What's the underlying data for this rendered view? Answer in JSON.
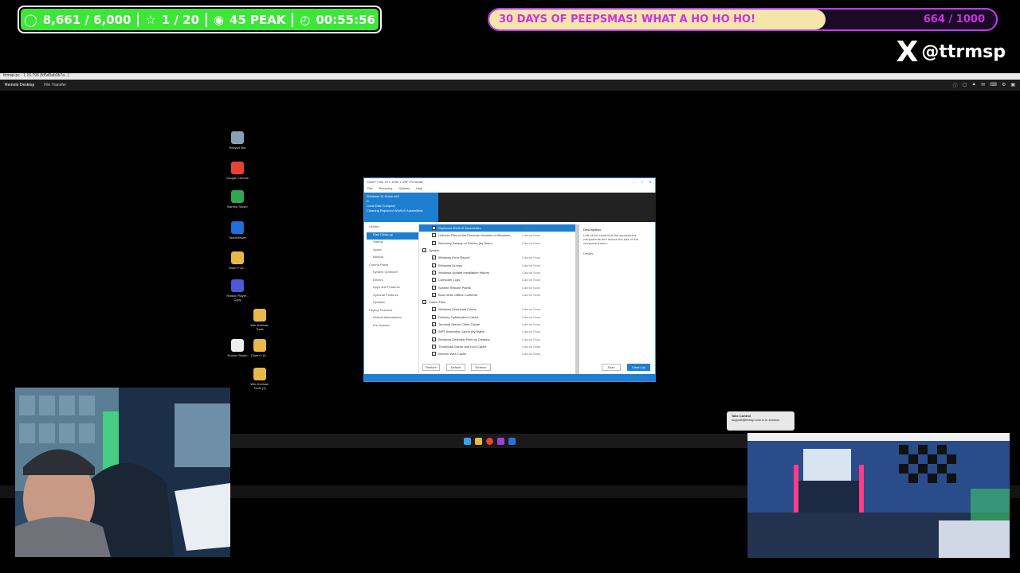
{
  "stream": {
    "followers": "8,661 / 6,000",
    "subs": "1 / 20",
    "viewers": "45 PEAK",
    "uptime": "00:55:56",
    "goal_text": "30 DAYS OF PEEPSMAS! WHAT A HO HO HO!",
    "goal_count": "664 / 1000",
    "goal_fraction": 0.664,
    "social_icon": "X",
    "social_handle": "@ttrmsp",
    "colors": {
      "stats_bg": "#3ee63a",
      "goal_border": "#c23cf4",
      "goal_fill": "#f3e6a8",
      "goal_text": "#cf2fe8"
    }
  },
  "remote": {
    "title": "ttrmsp-pc - 1.16.796 (fd5d0ab3b7a...)",
    "tabs": [
      "Remote Desktop",
      "File Transfer"
    ]
  },
  "desktop_icons": [
    {
      "label": "Recycle Bin",
      "icon": "recycle-bin-icon",
      "color": "#8aa0b5"
    },
    {
      "label": "Google Chrome",
      "icon": "chrome-icon",
      "color": "#e94235"
    },
    {
      "label": "Bambu Studio",
      "icon": "bambu-icon",
      "color": "#2fa84f"
    },
    {
      "label": "TeamViewer",
      "icon": "teamviewer-icon",
      "color": "#1e6fd9"
    },
    {
      "label": "Dism++10...",
      "icon": "folder-icon",
      "color": "#e8b84a"
    },
    {
      "label": "Roblox Player - Copy",
      "icon": "roblox-icon",
      "color": "#4a5ad9"
    },
    {
      "label": "Win-Debloat-Tools",
      "icon": "folder-icon",
      "color": "#e8b84a"
    },
    {
      "label": "Roblox Studio",
      "icon": "roblox-studio-icon",
      "color": "#eeeeee"
    },
    {
      "label": "Dism++10...",
      "icon": "folder-icon",
      "color": "#e8b84a"
    },
    {
      "label": "Win-Debloat-Tools (1)",
      "icon": "folder-icon",
      "color": "#e8b84a"
    }
  ],
  "dism": {
    "title": "Dism++x64 10.1.1002.1 UEFI Firmware",
    "window_controls": [
      "–",
      "□",
      "✕"
    ],
    "menu": [
      "File",
      "Recovery",
      "Options",
      "Help"
    ],
    "banner_lines": [
      "Windows 11 Home x64",
      "C:",
      "Local Disk Compact",
      "Cleaning Replaced WinSxS Assemblies"
    ],
    "sidebar": [
      {
        "label": "Utilities",
        "sub": false,
        "sel": false
      },
      {
        "label": "Disk Clean-up",
        "sub": true,
        "sel": true
      },
      {
        "label": "Startup",
        "sub": true,
        "sel": false
      },
      {
        "label": "Appxs",
        "sub": true,
        "sel": false
      },
      {
        "label": "Backup",
        "sub": true,
        "sel": false
      },
      {
        "label": "Control Panel",
        "sub": false,
        "sel": false
      },
      {
        "label": "System Optimizer",
        "sub": true,
        "sel": false
      },
      {
        "label": "Drivers",
        "sub": true,
        "sel": false
      },
      {
        "label": "Apps and Features",
        "sub": true,
        "sel": false
      },
      {
        "label": "Optional Features",
        "sub": true,
        "sel": false
      },
      {
        "label": "Updates",
        "sub": true,
        "sel": false
      },
      {
        "label": "Deploy Features",
        "sub": false,
        "sel": false
      },
      {
        "label": "Default Associations",
        "sub": true,
        "sel": false
      },
      {
        "label": "Pre-Answer",
        "sub": true,
        "sel": false
      }
    ],
    "rows": [
      {
        "label": "Replaced WinSxS Assemblies",
        "status": "Scan",
        "hd": false,
        "sel": true
      },
      {
        "label": "Leftover Files of the Previous Versions of Windows",
        "status": "Cannot Scan",
        "hd": false,
        "sel": false
      },
      {
        "label": "Recovery Backup of Drivers (by Dism)",
        "status": "Cannot Scan",
        "hd": false,
        "sel": false
      },
      {
        "label": "System",
        "status": "",
        "hd": true,
        "sel": false
      },
      {
        "label": "Windows Error Report",
        "status": "Cannot Scan",
        "hd": false,
        "sel": false
      },
      {
        "label": "Windows Dumps",
        "status": "Cannot Scan",
        "hd": false,
        "sel": false
      },
      {
        "label": "Windows Update Installation History",
        "status": "Cannot Scan",
        "hd": false,
        "sel": false
      },
      {
        "label": "Computer Logs",
        "status": "Cannot Scan",
        "hd": false,
        "sel": false
      },
      {
        "label": "System Restore Points",
        "status": "Cannot Scan",
        "hd": false,
        "sel": false
      },
      {
        "label": "Boot Items Offline Contents",
        "status": "Cannot Scan",
        "hd": false,
        "sel": false
      },
      {
        "label": "Cache Files",
        "status": "",
        "hd": true,
        "sel": false
      },
      {
        "label": "Windows Download Cache",
        "status": "Cannot Scan",
        "hd": false,
        "sel": false
      },
      {
        "label": "Delivery Optimization Cache",
        "status": "Cannot Scan",
        "hd": false,
        "sel": false
      },
      {
        "label": "Terminal Server Client Cache",
        "status": "Cannot Scan",
        "hd": false,
        "sel": false
      },
      {
        "label": "WPF Assembly Cache (by Ngen)",
        "status": "Cannot Scan",
        "hd": false,
        "sel": false
      },
      {
        "label": "Windows Defender Files by Cleanup",
        "status": "Cannot Scan",
        "hd": false,
        "sel": false
      },
      {
        "label": "Thumbnail Cache and Icon Cache",
        "status": "Cannot Scan",
        "hd": false,
        "sel": false
      },
      {
        "label": "Internet Web Cache",
        "status": "Cannot Scan",
        "hd": false,
        "sel": false
      }
    ],
    "desc_title": "Description",
    "desc_text": "Lots of the content of the superseded components and reduce the size of the component store.",
    "desc_details": "Details",
    "buttons": {
      "recommend": "Restore",
      "default": "Default",
      "refresh": "Refresh",
      "scan": "Scan",
      "cleanup": "Clean Up"
    }
  },
  "notification": {
    "title": "Take Control",
    "body": "support@ttrmsp.com is in session"
  }
}
